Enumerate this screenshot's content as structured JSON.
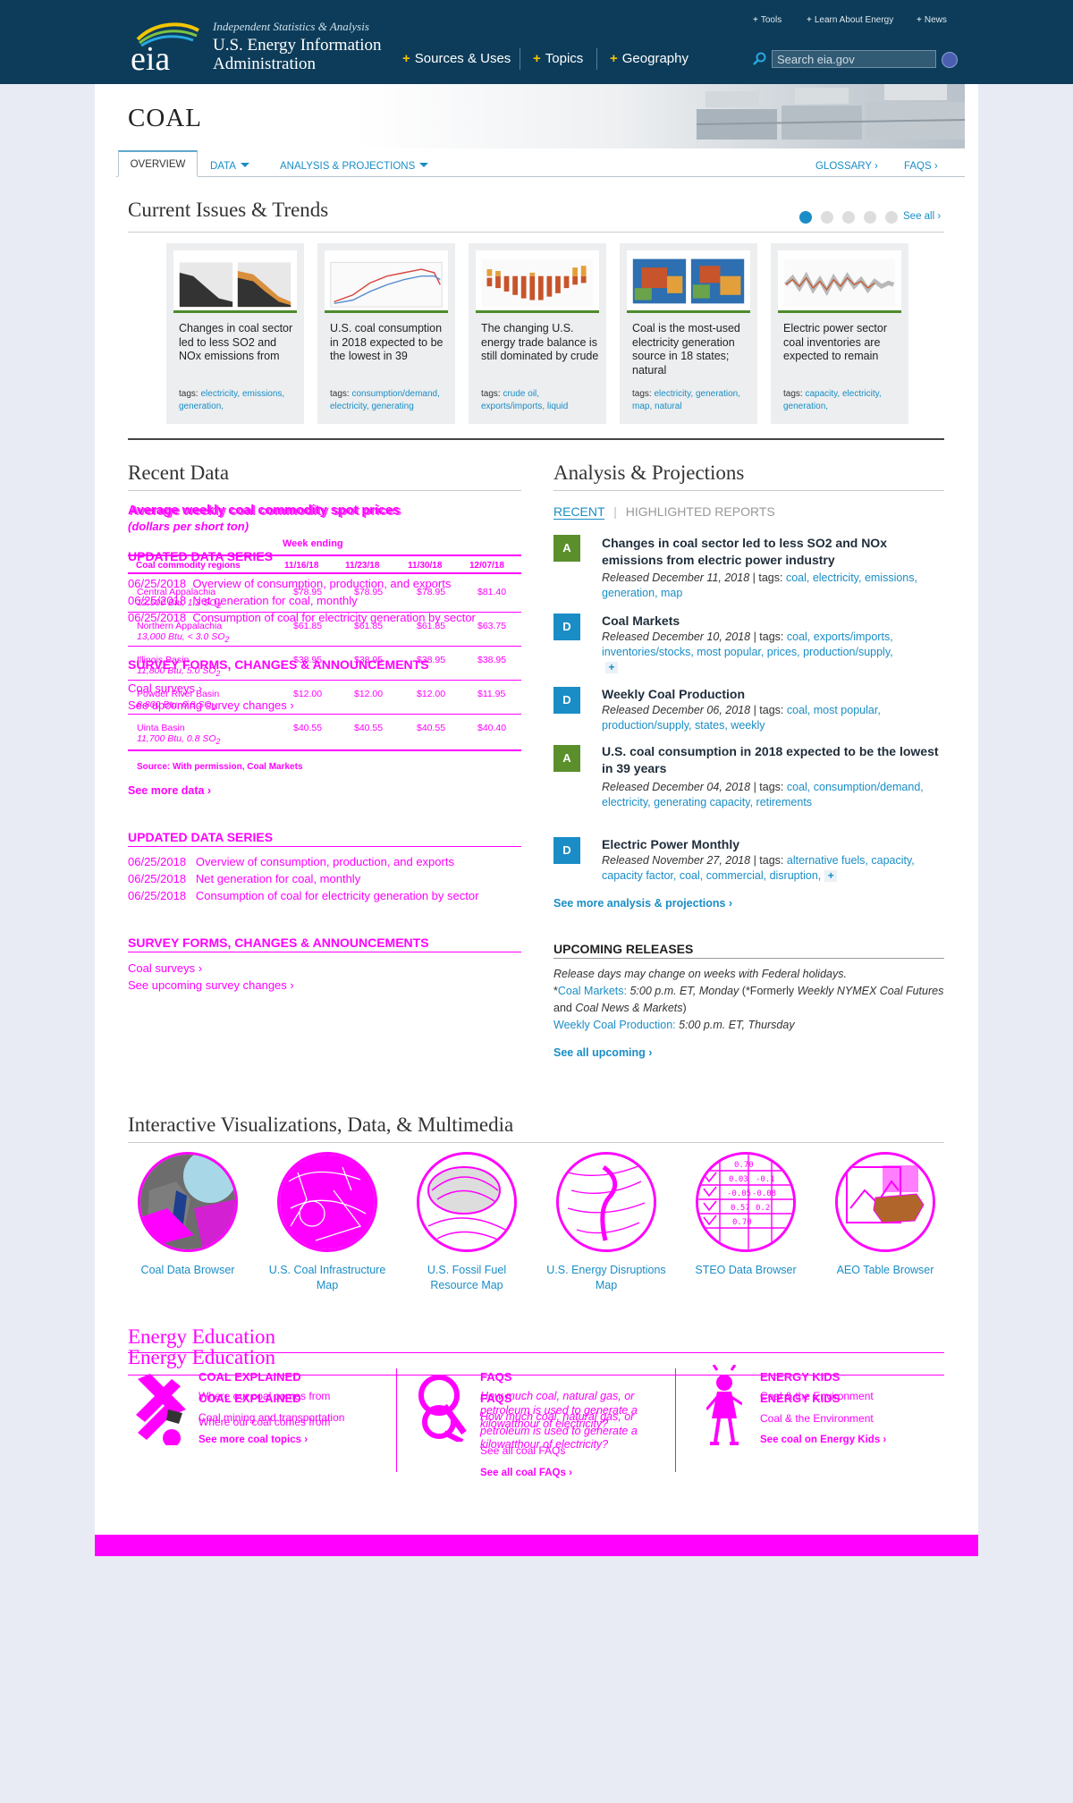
{
  "header": {
    "logo_text": "eia",
    "tagline": "Independent Statistics & Analysis",
    "org_name": "U.S. Energy Information Administration",
    "nav_main": [
      "Sources & Uses",
      "Topics",
      "Geography"
    ],
    "nav_top": [
      "Tools",
      "Learn About Energy",
      "News"
    ],
    "search_placeholder": "Search eia.gov"
  },
  "page": {
    "title": "COAL",
    "tabs": [
      "OVERVIEW",
      "DATA",
      "ANALYSIS & PROJECTIONS"
    ],
    "right_links": [
      "GLOSSARY ›",
      "FAQS ›"
    ]
  },
  "trends": {
    "heading": "Current Issues & Trends",
    "see_all": "See all ›",
    "cards": [
      {
        "title": "Changes in coal sector led to less SO2 and NOx emissions from",
        "tags_label": "tags:",
        "tags": "electricity, emissions, generation,"
      },
      {
        "title": "U.S. coal consumption in 2018 expected to be the lowest in 39",
        "tags_label": "tags:",
        "tags": "consumption/demand, electricity, generating"
      },
      {
        "title": "The changing U.S. energy trade balance is still dominated by crude",
        "tags_label": "tags:",
        "tags": "crude oil, exports/imports, liquid"
      },
      {
        "title": "Coal is the most-used electricity generation source in 18 states; natural",
        "tags_label": "tags:",
        "tags": "electricity, generation, map, natural"
      },
      {
        "title": "Electric power sector coal inventories are expected to remain",
        "tags_label": "tags:",
        "tags": "capacity, electricity, generation,"
      }
    ]
  },
  "recent_data": {
    "heading": "Recent Data",
    "table_title_a": "Average weekly coal commodity spot prices",
    "table_title_b": "Average weekly coal commodity spot prices",
    "table_unit": "(dollars per short ton)",
    "week_ending": "Week ending",
    "columns": [
      "Coal commodity regions",
      "11/16/18",
      "11/23/18",
      "11/30/18",
      "12/07/18"
    ],
    "rows": [
      {
        "region": "Central Appalachia",
        "spec": "12,500 Btu, 1.2 SO",
        "values": [
          "$78.95",
          "$78.95",
          "$78.95",
          "$81.40"
        ]
      },
      {
        "region": "Northern Appalachia",
        "spec": "13,000 Btu, < 3.0 SO",
        "values": [
          "$61.85",
          "$61.85",
          "$61.85",
          "$63.75"
        ]
      },
      {
        "region": "Illinois Basin",
        "spec": "11,800 Btu, 5.0 SO",
        "values": [
          "$38.95",
          "$38.95",
          "$38.95",
          "$38.95"
        ]
      },
      {
        "region": "Powder River Basin",
        "spec": "8,800 Btu, 0.8 SO",
        "values": [
          "$12.00",
          "$12.00",
          "$12.00",
          "$11.95"
        ]
      },
      {
        "region": "Uinta Basin",
        "spec": "11,700 Btu, 0.8 SO",
        "values": [
          "$40.55",
          "$40.55",
          "$40.55",
          "$40.40"
        ]
      }
    ],
    "subscript": "2",
    "source": "Source: With permission, Coal Markets",
    "see_more": "See more data ›",
    "updated_heading": "UPDATED DATA SERIES",
    "updated": [
      {
        "date": "06/25/2018",
        "text": "Overview of consumption, production, and exports"
      },
      {
        "date": "06/25/2018",
        "text": "Net generation for coal, monthly"
      },
      {
        "date": "06/25/2018",
        "text": "Consumption of coal for electricity generation by sector"
      }
    ],
    "survey_heading": "SURVEY FORMS, CHANGES & ANNOUNCEMENTS",
    "survey_links": [
      "Coal surveys ›",
      "See upcoming survey changes ›"
    ]
  },
  "analysis": {
    "heading": "Analysis & Projections",
    "tab_recent": "RECENT",
    "tab_sep": "|",
    "tab_highlighted": "HIGHLIGHTED REPORTS",
    "items": [
      {
        "badge": "A",
        "badge_color": "#5a8f2c",
        "title": "Changes in coal sector led to less SO2 and NOx emissions from electric power industry",
        "released": "Released December 11, 2018",
        "tags_label": "| tags:",
        "tags": "coal, electricity, emissions, generation, map",
        "more": ""
      },
      {
        "badge": "D",
        "badge_color": "#1a8dc6",
        "title": "Coal Markets",
        "released": "Released December 10, 2018",
        "tags_label": "| tags:",
        "tags": "coal, exports/imports, inventories/stocks, most popular, prices, production/supply,",
        "more": "+"
      },
      {
        "badge": "D",
        "badge_color": "#1a8dc6",
        "title": "Weekly Coal Production",
        "released": "Released December 06, 2018",
        "tags_label": "| tags:",
        "tags": "coal, most popular, production/supply, states, weekly",
        "more": ""
      },
      {
        "badge": "A",
        "badge_color": "#5a8f2c",
        "title": "U.S. coal consumption in 2018 expected to be the lowest in 39 years",
        "released": "Released December 04, 2018",
        "tags_label": "| tags:",
        "tags": "coal, consumption/demand, electricity, generating capacity, retirements",
        "more": ""
      },
      {
        "badge": "D",
        "badge_color": "#1a8dc6",
        "title": "Electric Power Monthly",
        "released": "Released November 27, 2018",
        "tags_label": "| tags:",
        "tags": "alternative fuels, capacity, capacity factor, coal, commercial, disruption,",
        "more": "+"
      }
    ],
    "see_more": "See more analysis & projections ›",
    "upcoming_heading": "UPCOMING RELEASES",
    "upcoming_note": "Release days may change on weeks with Federal holidays.",
    "upcoming_1_star": "*",
    "upcoming_1_link": "Coal Markets:",
    "upcoming_1_time": "5:00 p.m. ET, Monday",
    "upcoming_1_note_a": "(*Formerly",
    "upcoming_1_note_b": "Weekly NYMEX Coal Futures",
    "upcoming_1_note_c": "and",
    "upcoming_1_note_d": "Coal News & Markets",
    "upcoming_1_note_e": ")",
    "upcoming_2_link": "Weekly Coal Production:",
    "upcoming_2_time": "5:00 p.m. ET, Thursday",
    "see_all_upcoming": "See all upcoming ›"
  },
  "viz": {
    "heading": "Interactive Visualizations, Data, & Multimedia",
    "items": [
      "Coal Data Browser",
      "U.S. Coal Infrastructure Map",
      "U.S. Fossil Fuel Resource Map",
      "U.S. Energy Disruptions Map",
      "STEO Data Browser",
      "AEO Table Browser"
    ],
    "steo_numbers": [
      "0.70",
      "0.03",
      "-0.1",
      "-0.05",
      "-0.08",
      "0.57",
      "0.2",
      "0.70"
    ]
  },
  "education": {
    "heading": "Energy Education",
    "coal_explained_heading": "COAL EXPLAINED",
    "coal_explained_text": "Where our coal comes from",
    "coal_explained_text2": "Where our coal comes from",
    "coal_explained_text3": "Where our coal comes from",
    "coal_explained_text4": "Where our coal comes from",
    "coal_explained_sub": "Coal mining and transportation",
    "coal_explained_link": "See more coal topics ›",
    "faqs_heading": "FAQS",
    "faqs_q1": "How much coal, natural gas, or petroleum is used to generate a kilowatthour of electricity?",
    "faqs_q2": "How much coal, natural gas, or petroleum is used to generate a kilowatthour of electricity?",
    "faqs_link": "See all coal FAQs ›",
    "faqs_link2": "See all coal FAQs",
    "kids_heading": "ENERGY KIDS",
    "kids_text": "Coal & the Environment",
    "kids_text2": "Coal & the Environment",
    "kids_link": "See coal on Energy Kids ›"
  },
  "colors": {
    "brand": "#0c3c5a",
    "link": "#1a8dc6",
    "accent": "#ff00ff"
  }
}
